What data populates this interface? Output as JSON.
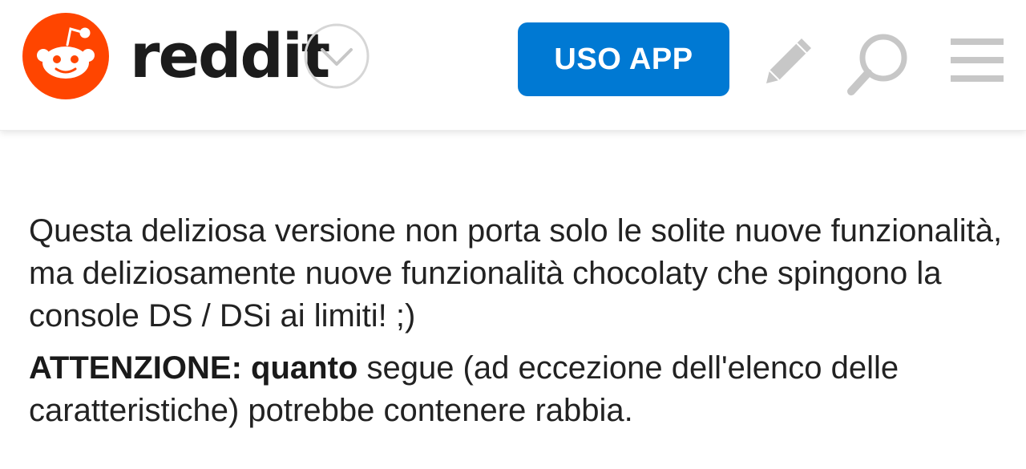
{
  "header": {
    "logo_icon": "reddit-snoo-icon",
    "wordmark": "reddit",
    "dropdown_icon": "chevron-down-icon",
    "app_button_label": "USO APP",
    "icons": [
      "pencil-icon",
      "search-icon",
      "hamburger-menu-icon"
    ]
  },
  "post": {
    "paragraph1": "Questa deliziosa versione non porta solo le solite nuove funzionalità, ma deliziosamente nuove funzionalità chocolaty che spingono la console DS / DSi ai limiti! ;)",
    "paragraph2": {
      "bold_part1": "ATTENZIONE:",
      "bold_part2": "quanto",
      "rest": " segue (ad eccezione dell'elenco delle caratteristiche) potrebbe contenere rabbia."
    }
  },
  "colors": {
    "brand_orange": "#ff4500",
    "button_blue": "#0079d3",
    "icon_gray": "#c7c7c7",
    "text": "#222222"
  }
}
